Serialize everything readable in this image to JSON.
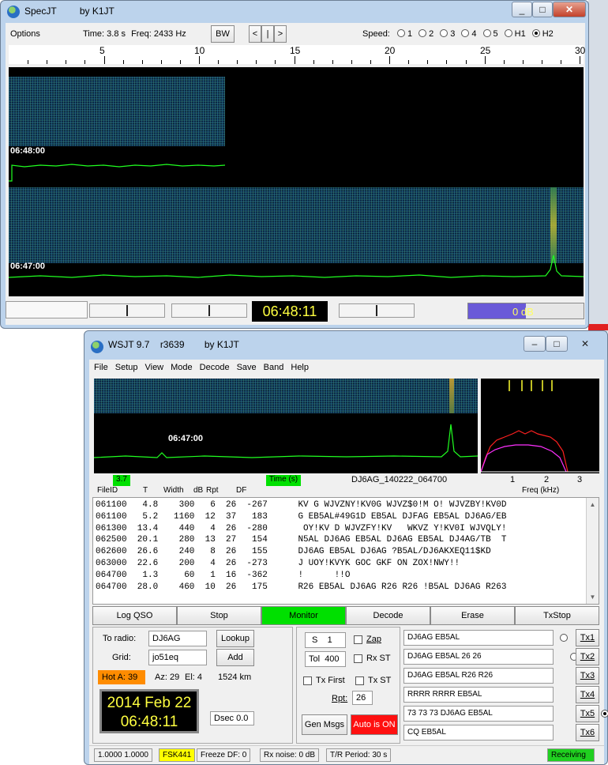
{
  "specjt": {
    "title": "SpecJT",
    "by": "by K1JT",
    "options": "Options",
    "time_label": "Time:",
    "time_val": "3.8 s",
    "freq_label": "Freq:",
    "freq_val": "2433 Hz",
    "bw": "BW",
    "nav_prev": "<",
    "nav_mid": "|",
    "nav_next": ">",
    "speed_label": "Speed:",
    "speeds": [
      "1",
      "2",
      "3",
      "4",
      "5",
      "H1",
      "H2"
    ],
    "speed_selected": "H2",
    "ruler_labels": [
      "5",
      "10",
      "15",
      "20",
      "25",
      "30"
    ],
    "time_top": "06:48:00",
    "time_bottom": "06:47:00",
    "clock": "06:48:11",
    "db": "0 dB"
  },
  "wsjt": {
    "title": "WSJT 9.7",
    "rev": "r3639",
    "by": "by K1JT",
    "menu": [
      "File",
      "Setup",
      "View",
      "Mode",
      "Decode",
      "Save",
      "Band",
      "Help"
    ],
    "wf_time": "06:47:00",
    "val_green": "3.7",
    "time_s": "Time (s)",
    "file_name": "DJ6AG_140222_064700",
    "freq_ticks": [
      "1",
      "2",
      "3"
    ],
    "freq_khz": "Freq (kHz)",
    "columns": {
      "fileid": "FileID",
      "t": "T",
      "width": "Width",
      "db": "dB",
      "rpt": "Rpt",
      "df": "DF"
    },
    "rows": [
      {
        "fileid": "061100",
        "t": "4.8",
        "width": "300",
        "db": "6",
        "rpt": "26",
        "df": "-267",
        "text": "KV G WJVZNY!KV0G WJVZ$0!M O! WJVZBY!KV0D"
      },
      {
        "fileid": "061100",
        "t": "5.2",
        "width": "1160",
        "db": "12",
        "rpt": "37",
        "df": "183",
        "text": "G EB5AL#49G1D EB5AL DJFAG EB5AL DJ6AG/EB"
      },
      {
        "fileid": "061300",
        "t": "13.4",
        "width": "440",
        "db": "4",
        "rpt": "26",
        "df": "-280",
        "text": " OY!KV D WJVZFY!KV   WKVZ Y!KV0I WJVQLY!"
      },
      {
        "fileid": "062500",
        "t": "20.1",
        "width": "280",
        "db": "13",
        "rpt": "27",
        "df": "154",
        "text": "N5AL DJ6AG EB5AL DJ6AG EB5AL DJ4AG/TB  T"
      },
      {
        "fileid": "062600",
        "t": "26.6",
        "width": "240",
        "db": "8",
        "rpt": "26",
        "df": "155",
        "text": "DJ6AG EB5AL DJ6AG ?B5AL/DJ6AKXEQ11$KD"
      },
      {
        "fileid": "063000",
        "t": "22.6",
        "width": "200",
        "db": "4",
        "rpt": "26",
        "df": "-273",
        "text": "J UOY!KVYK GOC GKF ON ZOX!NWY!!"
      },
      {
        "fileid": "064700",
        "t": "1.3",
        "width": "60",
        "db": "1",
        "rpt": "16",
        "df": "-362",
        "text": "!      !!O"
      },
      {
        "fileid": "064700",
        "t": "28.0",
        "width": "460",
        "db": "10",
        "rpt": "26",
        "df": "175",
        "text": "R26 EB5AL DJ6AG R26 R26 !B5AL DJ6AG R263"
      }
    ],
    "buttons": [
      "Log QSO",
      "Stop",
      "Monitor",
      "Decode",
      "Erase",
      "TxStop"
    ],
    "to_radio_label": "To radio:",
    "to_radio": "DJ6AG",
    "grid_label": "Grid:",
    "grid": "jo51eq",
    "lookup": "Lookup",
    "add": "Add",
    "hot_a": "Hot A: 39",
    "az": "Az: 29",
    "el": "El: 4",
    "dist": "1524 km",
    "date": "2014 Feb 22",
    "clock": "06:48:11",
    "dsec": "Dsec  0.0",
    "s_label": "S",
    "s_val": "1",
    "tol_label": "Tol",
    "tol_val": "400",
    "zap": "Zap",
    "rx_st": "Rx ST",
    "tx_first": "Tx First",
    "tx_st": "Tx ST",
    "rpt_label": "Rpt:",
    "rpt_val": "26",
    "gen_msgs": "Gen Msgs",
    "auto": "Auto is  ON",
    "tx_msgs": [
      {
        "msg": "DJ6AG EB5AL",
        "btn": "Tx1",
        "on": false
      },
      {
        "msg": "DJ6AG EB5AL 26 26",
        "btn": "Tx2",
        "on": false
      },
      {
        "msg": "DJ6AG EB5AL R26 R26",
        "btn": "Tx3",
        "on": false
      },
      {
        "msg": "RRRR RRRR EB5AL",
        "btn": "Tx4",
        "on": false
      },
      {
        "msg": "73 73 73 DJ6AG EB5AL",
        "btn": "Tx5",
        "on": true
      },
      {
        "msg": "CQ EB5AL",
        "btn": "Tx6",
        "on": false
      }
    ],
    "status": {
      "ratio": "1.0000 1.0000",
      "mode": "FSK441",
      "freeze": "Freeze DF:  0",
      "rx_noise": "Rx noise:  0 dB",
      "tr": "T/R Period: 30 s",
      "state": "Receiving"
    },
    "colors": {
      "monitor": "#00e000",
      "auto": "#ff1010",
      "hot": "#ff8c00",
      "mode": "#ffff00",
      "receiving": "#20d020",
      "clock_text": "#ffff40"
    }
  }
}
